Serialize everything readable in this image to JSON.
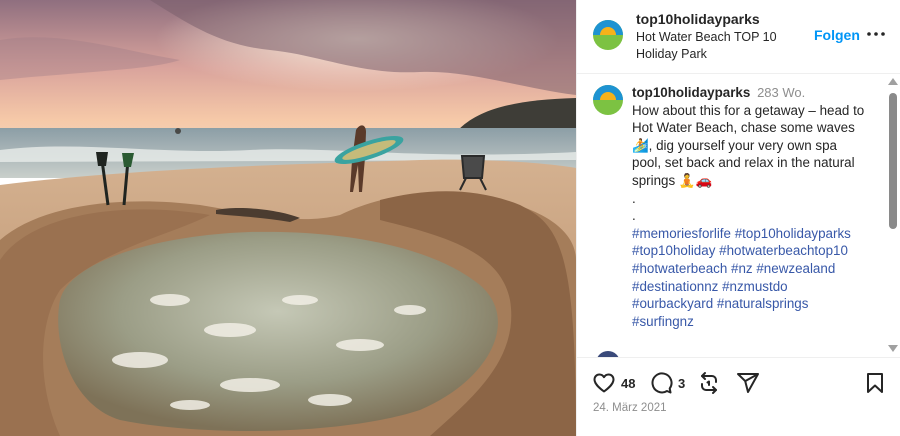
{
  "post": {
    "username": "top10holidayparks",
    "location": "Hot Water Beach TOP 10 Holiday Park",
    "follow_label": "Folgen",
    "more_icon": "more-horizontal-icon"
  },
  "photo": {
    "icon": "beach-photo",
    "colors": {
      "sky_top": "#8f6f7f",
      "sky_glow": "#f6c9a8",
      "sea": "#aeb8b6",
      "sand": "#c9a27e",
      "pool": "#9aa08a"
    }
  },
  "caption": {
    "username": "top10holidayparks",
    "time": "283 Wo.",
    "lines": [
      "How about this for a getaway – head to",
      "Hot Water Beach, chase some waves",
      "🏄, dig yourself your very own spa",
      "pool, set back and relax in the natural",
      "springs 🧘🚗",
      ".",
      "."
    ],
    "hashtag_lines": [
      [
        "#memoriesforlife",
        "#top10holidayparks"
      ],
      [
        "#top10holiday",
        "#hotwaterbeachtop10"
      ],
      [
        "#hotwaterbeach",
        "#nz",
        "#newzealand"
      ],
      [
        "#destinationnz",
        "#nzmustdo"
      ],
      [
        "#ourbackyard",
        "#naturalsprings"
      ],
      [
        "#surfingnz"
      ]
    ]
  },
  "actions": {
    "like_icon": "heart-icon",
    "like_count": "48",
    "comment_icon": "comment-icon",
    "comment_count": "3",
    "repost_icon": "repost-icon",
    "share_icon": "share-icon",
    "save_icon": "bookmark-icon",
    "date": "24. März 2021"
  },
  "colors": {
    "accent": "#0095f6",
    "hashtag": "#3858a8",
    "muted": "#8e8e8e",
    "text": "#262626"
  }
}
